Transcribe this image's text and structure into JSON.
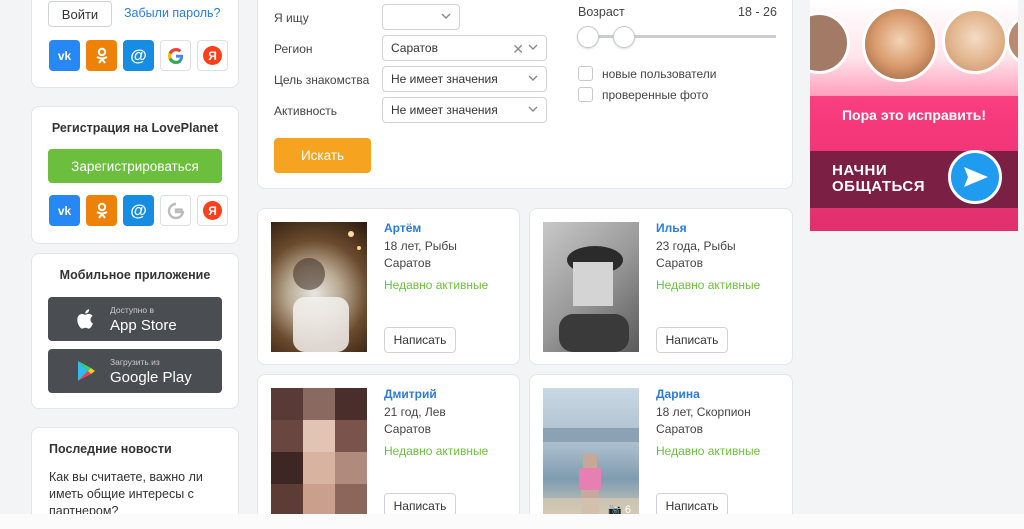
{
  "login": {
    "login_button": "Войти",
    "forgot_link": "Забыли пароль?"
  },
  "social_labels": {
    "vk": "vk",
    "ok": "ok",
    "mail": "@",
    "google": "G",
    "yandex": "Я"
  },
  "registration": {
    "title": "Регистрация на LovePlanet",
    "button": "Зарегистрироваться"
  },
  "mobile_app": {
    "title": "Мобильное приложение",
    "appstore_small": "Доступно в",
    "appstore_big": "App Store",
    "googleplay_small": "Загрузить из",
    "googleplay_big": "Google Play"
  },
  "news": {
    "title": "Последние новости",
    "text": "Как вы считаете, важно ли иметь общие интересы с партнером?"
  },
  "search": {
    "looking_for_label": "Я ищу",
    "looking_for_value": "",
    "region_label": "Регион",
    "region_value": "Саратов",
    "goal_label": "Цель знакомства",
    "goal_value": "Не имеет значения",
    "activity_label": "Активность",
    "activity_value": "Не имеет значения",
    "search_button": "Искать",
    "age_label": "Возраст",
    "age_range": "18 - 26",
    "age_min": 18,
    "age_max": 26,
    "new_users_label": "новые пользователи",
    "new_users_checked": false,
    "verified_photo_label": "проверенные фото",
    "verified_photo_checked": false
  },
  "profiles": [
    {
      "name": "Артём",
      "age": "18 лет, Рыбы",
      "city": "Саратов",
      "status": "Недавно активные",
      "button": "Написать"
    },
    {
      "name": "Илья",
      "age": "23 года, Рыбы",
      "city": "Саратов",
      "status": "Недавно активные",
      "button": "Написать"
    },
    {
      "name": "Дмитрий",
      "age": "21 год, Лев",
      "city": "Саратов",
      "status": "Недавно активные",
      "button": "Написать"
    },
    {
      "name": "Дарина",
      "age": "18 лет, Скорпион",
      "city": "Саратов",
      "status": "Недавно активные",
      "button": "Написать",
      "photo_count": "6"
    }
  ],
  "banner": {
    "slogan": "Пора это исправить!",
    "cta_line1": "НАЧНИ",
    "cta_line2": "ОБЩАТЬСЯ"
  },
  "colors": {
    "link": "#2b7cd3",
    "register_green": "#6bbf3d",
    "search_orange": "#f6a320",
    "status_green": "#6bbf3d"
  }
}
